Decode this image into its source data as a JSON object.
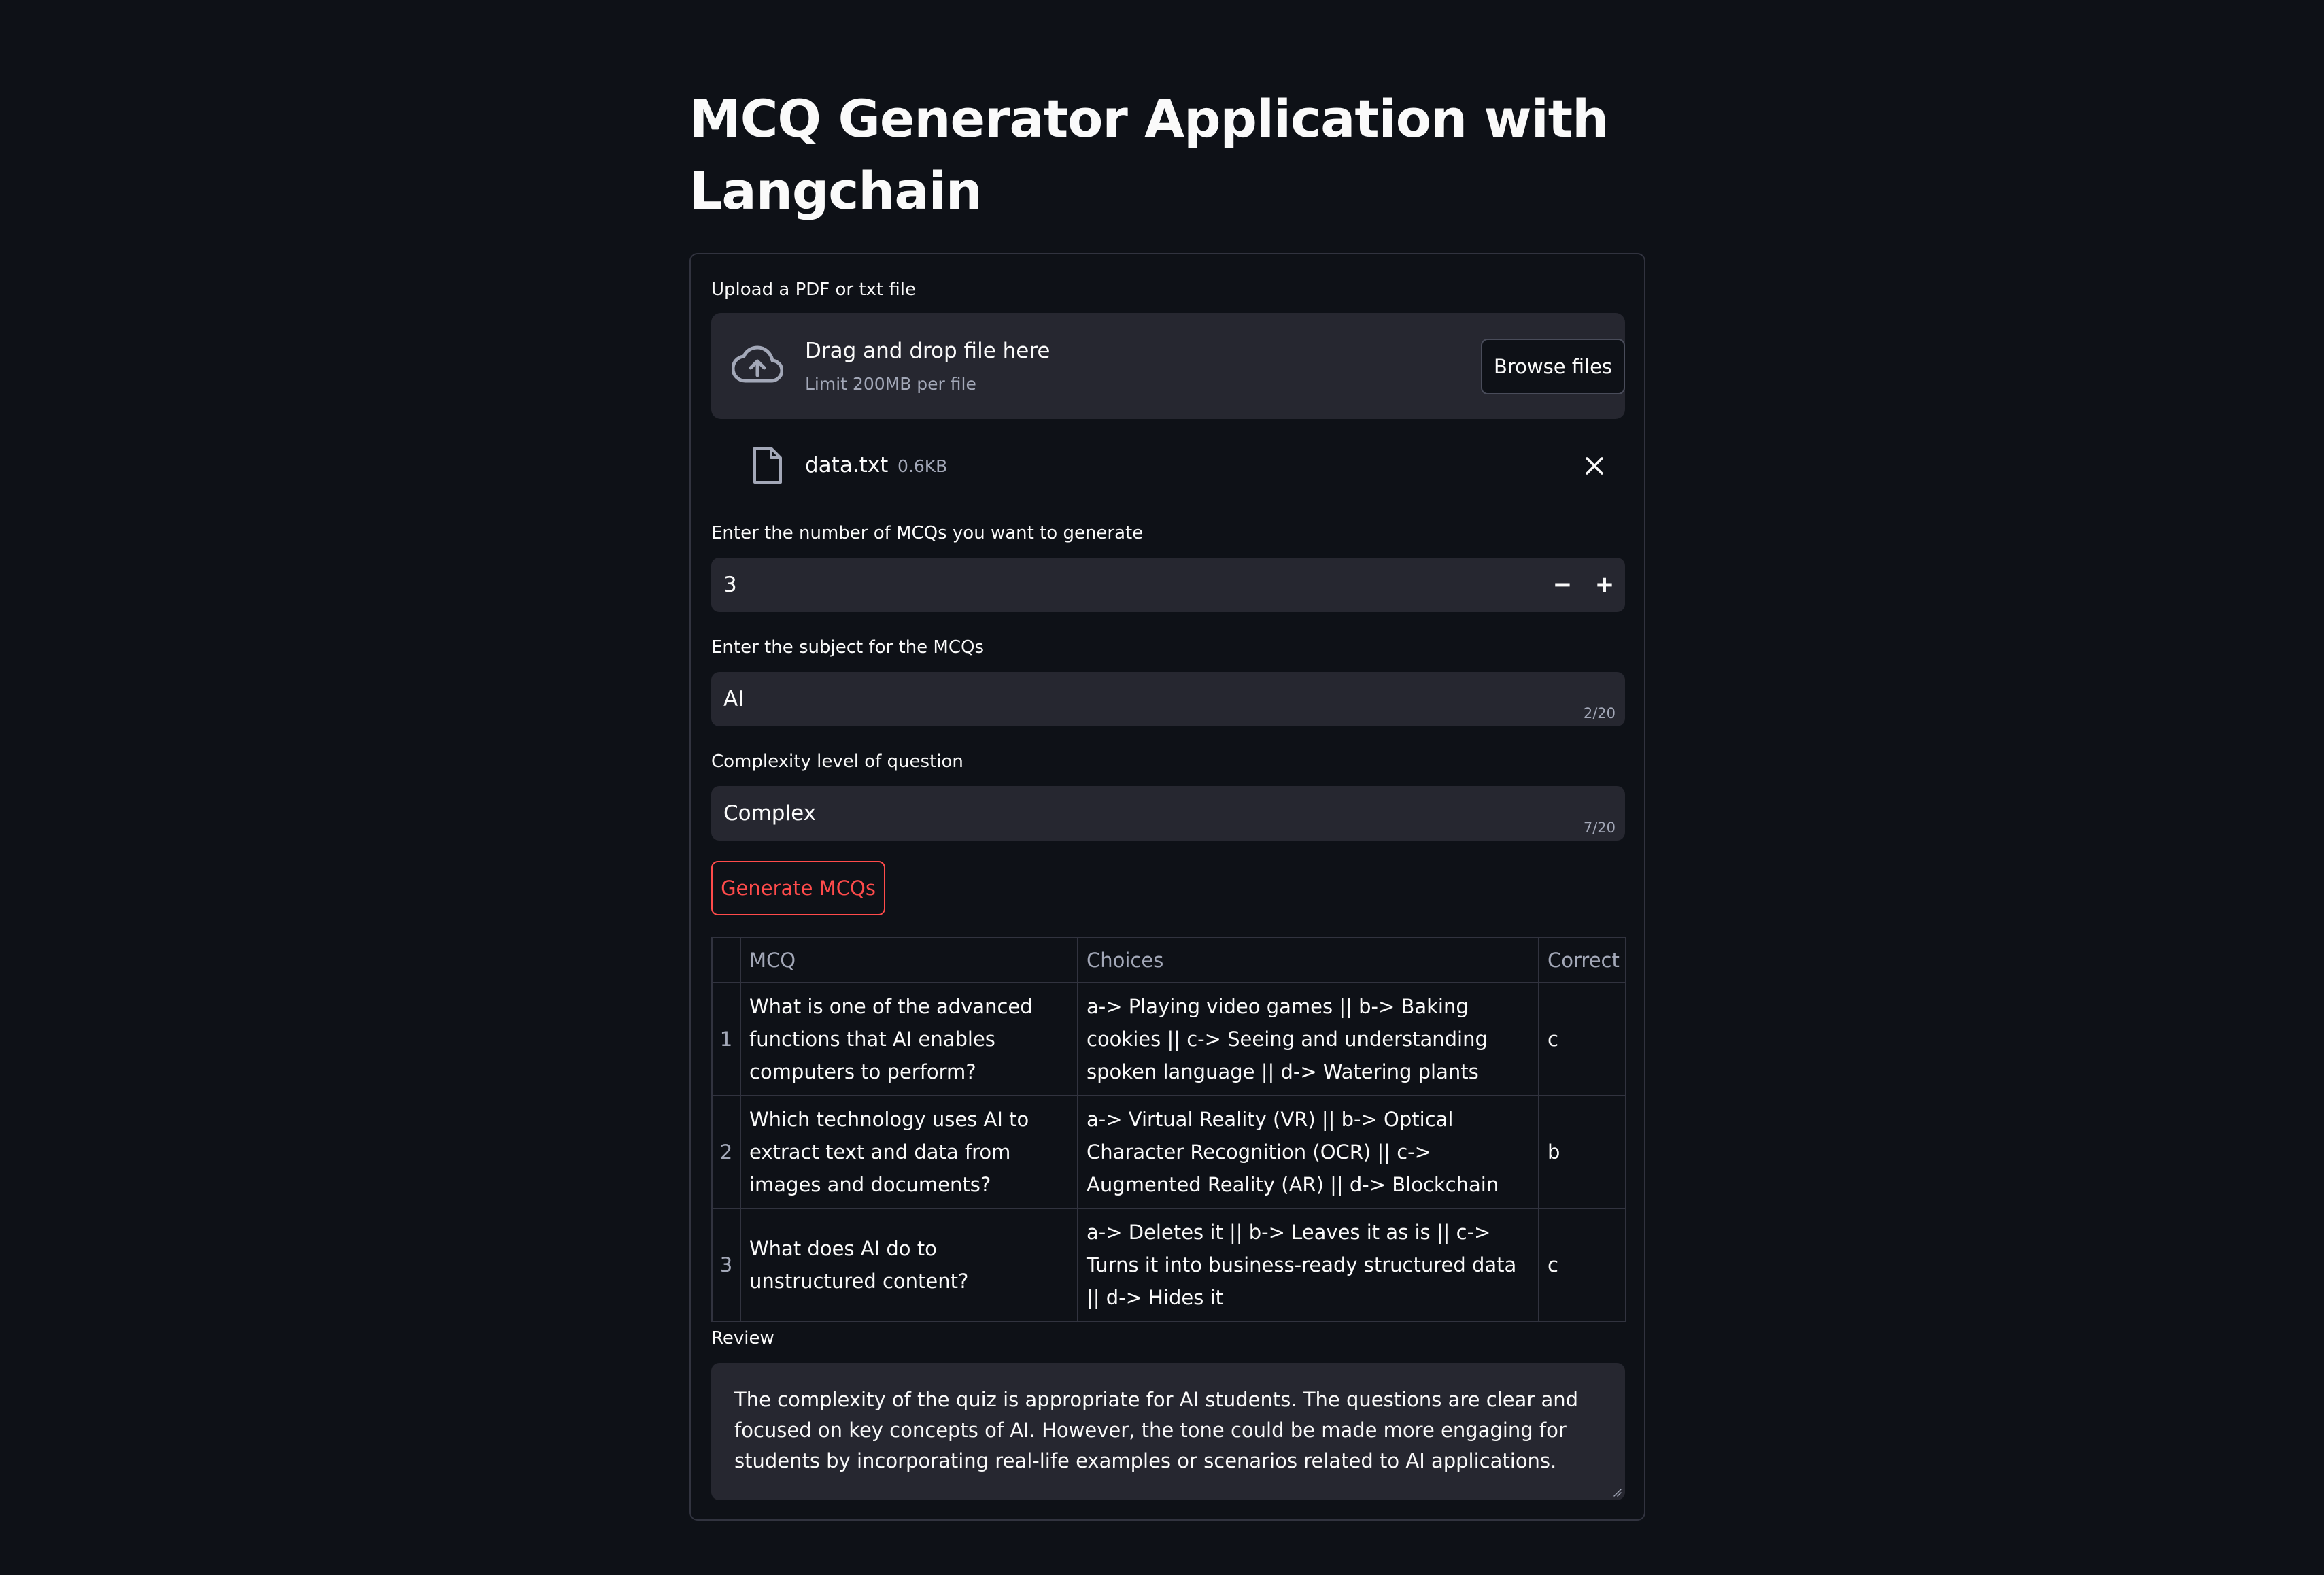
{
  "page": {
    "title": "MCQ Generator Application with Langchain"
  },
  "upload": {
    "label": "Upload a PDF or txt file",
    "dropzone_title": "Drag and drop file here",
    "dropzone_limit": "Limit 200MB per file",
    "browse_label": "Browse files",
    "file_name": "data.txt",
    "file_size": "0.6KB",
    "icons": {
      "upload": "cloud-upload-icon",
      "file": "file-icon",
      "remove": "close-icon"
    }
  },
  "mcq_count": {
    "label": "Enter the number of MCQs you want to generate",
    "value": "3",
    "minus_label": "−",
    "plus_label": "+"
  },
  "subject": {
    "label": "Enter the subject for the MCQs",
    "value": "AI",
    "counter": "2/20"
  },
  "complexity": {
    "label": "Complexity level of question",
    "value": "Complex",
    "counter": "7/20"
  },
  "generate": {
    "label": "Generate MCQs",
    "accent_color": "#ff4b4b"
  },
  "table": {
    "headers": [
      "MCQ",
      "Choices",
      "Correct"
    ],
    "rows": [
      {
        "index": "1",
        "mcq": "What is one of the advanced functions that AI enables computers to perform?",
        "choices": "a-> Playing video games || b-> Baking cookies || c-> Seeing and understanding spoken language || d-> Watering plants",
        "correct": "c"
      },
      {
        "index": "2",
        "mcq": "Which technology uses AI to extract text and data from images and documents?",
        "choices": "a-> Virtual Reality (VR) || b-> Optical Character Recognition (OCR) || c-> Augmented Reality (AR) || d-> Blockchain",
        "correct": "b"
      },
      {
        "index": "3",
        "mcq": "What does AI do to unstructured content?",
        "choices": "a-> Deletes it || b-> Leaves it as is || c-> Turns it into business-ready structured data || d-> Hides it",
        "correct": "c"
      }
    ]
  },
  "review": {
    "label": "Review",
    "text": "The complexity of the quiz is appropriate for AI students. The questions are clear and focused on key concepts of AI. However, the tone could be made more engaging for students by incorporating real-life examples or scenarios related to AI applications."
  }
}
